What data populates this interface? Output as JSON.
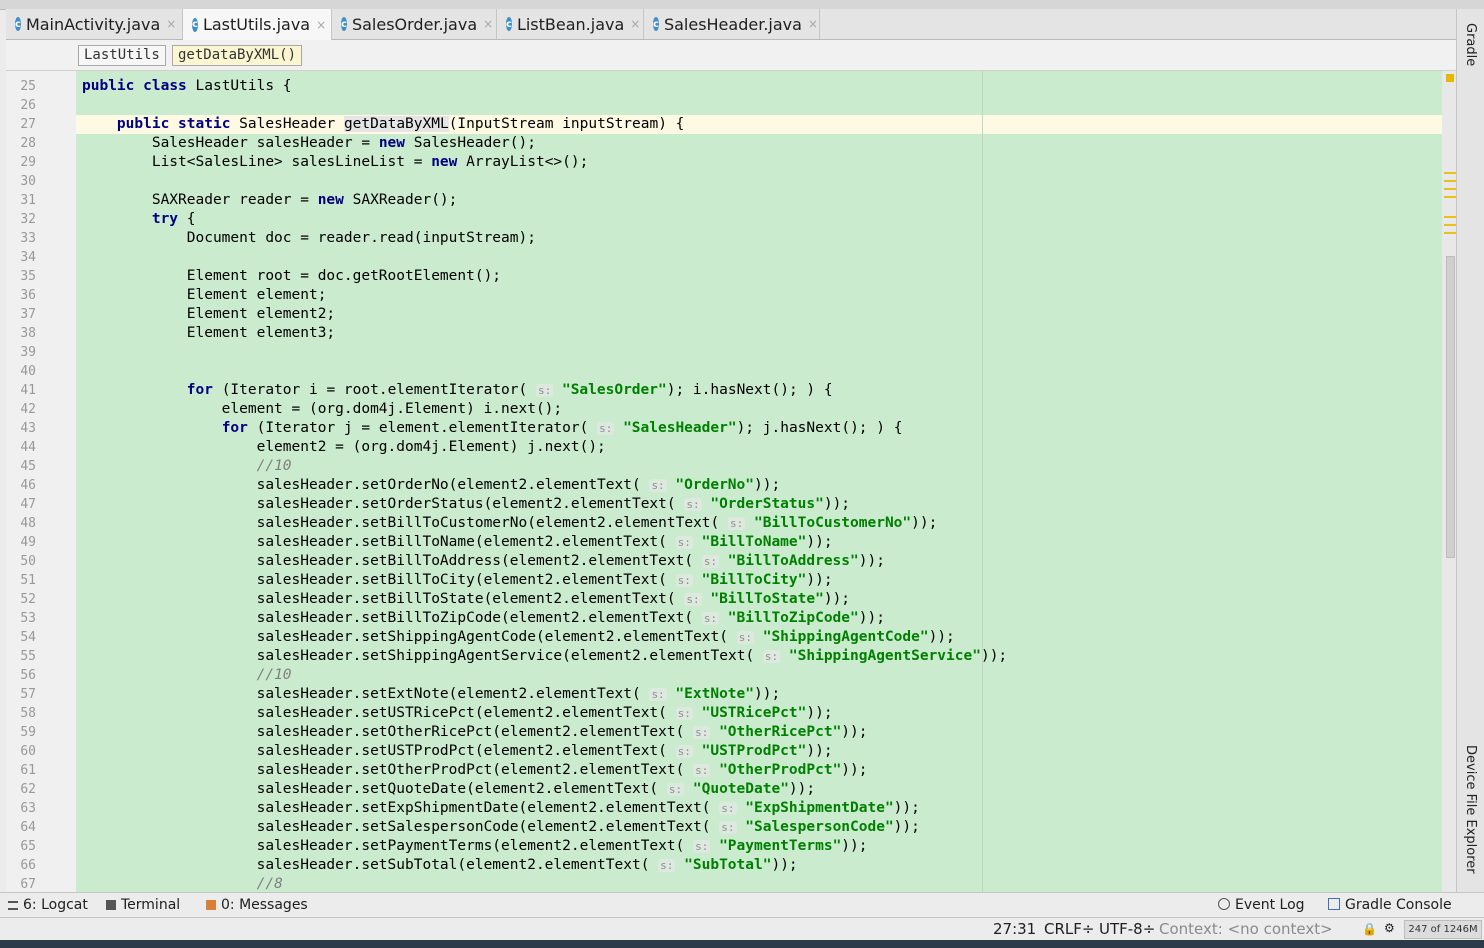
{
  "tabs": [
    {
      "label": "MainActivity.java",
      "active": false
    },
    {
      "label": "LastUtils.java",
      "active": true
    },
    {
      "label": "SalesOrder.java",
      "active": false
    },
    {
      "label": "ListBean.java",
      "active": false
    },
    {
      "label": "SalesHeader.java",
      "active": false
    }
  ],
  "tab_icon_letter": "c",
  "tab_close_glyph": "×",
  "breadcrumb": {
    "class_name": "LastUtils",
    "method_name": "getDataByXML()"
  },
  "line_numbers": [
    "25",
    "26",
    "27",
    "28",
    "29",
    "30",
    "31",
    "32",
    "33",
    "34",
    "35",
    "36",
    "37",
    "38",
    "39",
    "40",
    "41",
    "42",
    "43",
    "44",
    "45",
    "46",
    "47",
    "48",
    "49",
    "50",
    "51",
    "52",
    "53",
    "54",
    "55",
    "56",
    "57",
    "58",
    "59",
    "60",
    "61",
    "62",
    "63",
    "64",
    "65",
    "66",
    "67"
  ],
  "code_lines": [
    [
      {
        "t": "public",
        "c": "kw"
      },
      {
        "t": " "
      },
      {
        "t": "class",
        "c": "kw"
      },
      {
        "t": " LastUtils {"
      }
    ],
    [],
    [
      {
        "t": "    "
      },
      {
        "t": "public",
        "c": "kw"
      },
      {
        "t": " "
      },
      {
        "t": "static",
        "c": "kw"
      },
      {
        "t": " SalesHeader "
      },
      {
        "t": "getDataByXML",
        "c": "mhi"
      },
      {
        "t": "(InputStream inputStream) {"
      }
    ],
    [
      {
        "t": "        SalesHeader salesHeader = "
      },
      {
        "t": "new",
        "c": "kw"
      },
      {
        "t": " SalesHeader();"
      }
    ],
    [
      {
        "t": "        List<SalesLine> salesLineList = "
      },
      {
        "t": "new",
        "c": "kw"
      },
      {
        "t": " ArrayList<>();"
      }
    ],
    [],
    [
      {
        "t": "        SAXReader reader = "
      },
      {
        "t": "new",
        "c": "kw"
      },
      {
        "t": " SAXReader();"
      }
    ],
    [
      {
        "t": "        "
      },
      {
        "t": "try",
        "c": "kw"
      },
      {
        "t": " {"
      }
    ],
    [
      {
        "t": "            Document doc = reader.read(inputStream);"
      }
    ],
    [],
    [
      {
        "t": "            Element root = doc.getRootElement();"
      }
    ],
    [
      {
        "t": "            Element element;"
      }
    ],
    [
      {
        "t": "            Element element2;"
      }
    ],
    [
      {
        "t": "            Element element3;"
      }
    ],
    [],
    [],
    [
      {
        "t": "            "
      },
      {
        "t": "for",
        "c": "kw"
      },
      {
        "t": " (Iterator i = root.elementIterator( "
      },
      {
        "t": "s:",
        "c": "hint"
      },
      {
        "t": " "
      },
      {
        "t": "\"SalesOrder\"",
        "c": "str"
      },
      {
        "t": "); i.hasNext(); ) {"
      }
    ],
    [
      {
        "t": "                element = (org.dom4j.Element) i.next();"
      }
    ],
    [
      {
        "t": "                "
      },
      {
        "t": "for",
        "c": "kw"
      },
      {
        "t": " (Iterator j = element.elementIterator( "
      },
      {
        "t": "s:",
        "c": "hint"
      },
      {
        "t": " "
      },
      {
        "t": "\"SalesHeader\"",
        "c": "str"
      },
      {
        "t": "); j.hasNext(); ) {"
      }
    ],
    [
      {
        "t": "                    element2 = (org.dom4j.Element) j.next();"
      }
    ],
    [
      {
        "t": "                    "
      },
      {
        "t": "//10",
        "c": "cmt"
      }
    ],
    [
      {
        "t": "                    salesHeader.setOrderNo(element2.elementText( "
      },
      {
        "t": "s:",
        "c": "hint"
      },
      {
        "t": " "
      },
      {
        "t": "\"OrderNo\"",
        "c": "str"
      },
      {
        "t": "));"
      }
    ],
    [
      {
        "t": "                    salesHeader.setOrderStatus(element2.elementText( "
      },
      {
        "t": "s:",
        "c": "hint"
      },
      {
        "t": " "
      },
      {
        "t": "\"OrderStatus\"",
        "c": "str"
      },
      {
        "t": "));"
      }
    ],
    [
      {
        "t": "                    salesHeader.setBillToCustomerNo(element2.elementText( "
      },
      {
        "t": "s:",
        "c": "hint"
      },
      {
        "t": " "
      },
      {
        "t": "\"BillToCustomerNo\"",
        "c": "str"
      },
      {
        "t": "));"
      }
    ],
    [
      {
        "t": "                    salesHeader.setBillToName(element2.elementText( "
      },
      {
        "t": "s:",
        "c": "hint"
      },
      {
        "t": " "
      },
      {
        "t": "\"BillToName\"",
        "c": "str"
      },
      {
        "t": "));"
      }
    ],
    [
      {
        "t": "                    salesHeader.setBillToAddress(element2.elementText( "
      },
      {
        "t": "s:",
        "c": "hint"
      },
      {
        "t": " "
      },
      {
        "t": "\"BillToAddress\"",
        "c": "str"
      },
      {
        "t": "));"
      }
    ],
    [
      {
        "t": "                    salesHeader.setBillToCity(element2.elementText( "
      },
      {
        "t": "s:",
        "c": "hint"
      },
      {
        "t": " "
      },
      {
        "t": "\"BillToCity\"",
        "c": "str"
      },
      {
        "t": "));"
      }
    ],
    [
      {
        "t": "                    salesHeader.setBillToState(element2.elementText( "
      },
      {
        "t": "s:",
        "c": "hint"
      },
      {
        "t": " "
      },
      {
        "t": "\"BillToState\"",
        "c": "str"
      },
      {
        "t": "));"
      }
    ],
    [
      {
        "t": "                    salesHeader.setBillToZipCode(element2.elementText( "
      },
      {
        "t": "s:",
        "c": "hint"
      },
      {
        "t": " "
      },
      {
        "t": "\"BillToZipCode\"",
        "c": "str"
      },
      {
        "t": "));"
      }
    ],
    [
      {
        "t": "                    salesHeader.setShippingAgentCode(element2.elementText( "
      },
      {
        "t": "s:",
        "c": "hint"
      },
      {
        "t": " "
      },
      {
        "t": "\"ShippingAgentCode\"",
        "c": "str"
      },
      {
        "t": "));"
      }
    ],
    [
      {
        "t": "                    salesHeader.setShippingAgentService(element2.elementText( "
      },
      {
        "t": "s:",
        "c": "hint"
      },
      {
        "t": " "
      },
      {
        "t": "\"ShippingAgentService\"",
        "c": "str"
      },
      {
        "t": "));"
      }
    ],
    [
      {
        "t": "                    "
      },
      {
        "t": "//10",
        "c": "cmt"
      }
    ],
    [
      {
        "t": "                    salesHeader.setExtNote(element2.elementText( "
      },
      {
        "t": "s:",
        "c": "hint"
      },
      {
        "t": " "
      },
      {
        "t": "\"ExtNote\"",
        "c": "str"
      },
      {
        "t": "));"
      }
    ],
    [
      {
        "t": "                    salesHeader.setUSTRicePct(element2.elementText( "
      },
      {
        "t": "s:",
        "c": "hint"
      },
      {
        "t": " "
      },
      {
        "t": "\"USTRicePct\"",
        "c": "str"
      },
      {
        "t": "));"
      }
    ],
    [
      {
        "t": "                    salesHeader.setOtherRicePct(element2.elementText( "
      },
      {
        "t": "s:",
        "c": "hint"
      },
      {
        "t": " "
      },
      {
        "t": "\"OtherRicePct\"",
        "c": "str"
      },
      {
        "t": "));"
      }
    ],
    [
      {
        "t": "                    salesHeader.setUSTProdPct(element2.elementText( "
      },
      {
        "t": "s:",
        "c": "hint"
      },
      {
        "t": " "
      },
      {
        "t": "\"USTProdPct\"",
        "c": "str"
      },
      {
        "t": "));"
      }
    ],
    [
      {
        "t": "                    salesHeader.setOtherProdPct(element2.elementText( "
      },
      {
        "t": "s:",
        "c": "hint"
      },
      {
        "t": " "
      },
      {
        "t": "\"OtherProdPct\"",
        "c": "str"
      },
      {
        "t": "));"
      }
    ],
    [
      {
        "t": "                    salesHeader.setQuoteDate(element2.elementText( "
      },
      {
        "t": "s:",
        "c": "hint"
      },
      {
        "t": " "
      },
      {
        "t": "\"QuoteDate\"",
        "c": "str"
      },
      {
        "t": "));"
      }
    ],
    [
      {
        "t": "                    salesHeader.setExpShipmentDate(element2.elementText( "
      },
      {
        "t": "s:",
        "c": "hint"
      },
      {
        "t": " "
      },
      {
        "t": "\"ExpShipmentDate\"",
        "c": "str"
      },
      {
        "t": "));"
      }
    ],
    [
      {
        "t": "                    salesHeader.setSalespersonCode(element2.elementText( "
      },
      {
        "t": "s:",
        "c": "hint"
      },
      {
        "t": " "
      },
      {
        "t": "\"SalespersonCode\"",
        "c": "str"
      },
      {
        "t": "));"
      }
    ],
    [
      {
        "t": "                    salesHeader.setPaymentTerms(element2.elementText( "
      },
      {
        "t": "s:",
        "c": "hint"
      },
      {
        "t": " "
      },
      {
        "t": "\"PaymentTerms\"",
        "c": "str"
      },
      {
        "t": "));"
      }
    ],
    [
      {
        "t": "                    salesHeader.setSubTotal(element2.elementText( "
      },
      {
        "t": "s:",
        "c": "hint"
      },
      {
        "t": " "
      },
      {
        "t": "\"SubTotal\"",
        "c": "str"
      },
      {
        "t": "));"
      }
    ],
    [
      {
        "t": "                    "
      },
      {
        "t": "//8",
        "c": "cmt"
      }
    ]
  ],
  "side_panels": {
    "top": "Gradle",
    "bottom": "Device File Explorer"
  },
  "bottom_tools": {
    "logcat": "6: Logcat",
    "terminal": "Terminal",
    "messages": "0: Messages",
    "event_log": "Event Log",
    "gradle_console": "Gradle Console"
  },
  "status": {
    "position": "27:31",
    "line_separator": "CRLF÷",
    "encoding": "UTF-8÷",
    "context": "Context: <no context>",
    "memory": "247 of 1246M"
  },
  "colors": {
    "editor_background": "#cbebcf",
    "keyword": "#000080",
    "string": "#008000",
    "comment": "#808080",
    "current_line": "#fdf9e3",
    "class_icon": "#3f8ec9"
  }
}
